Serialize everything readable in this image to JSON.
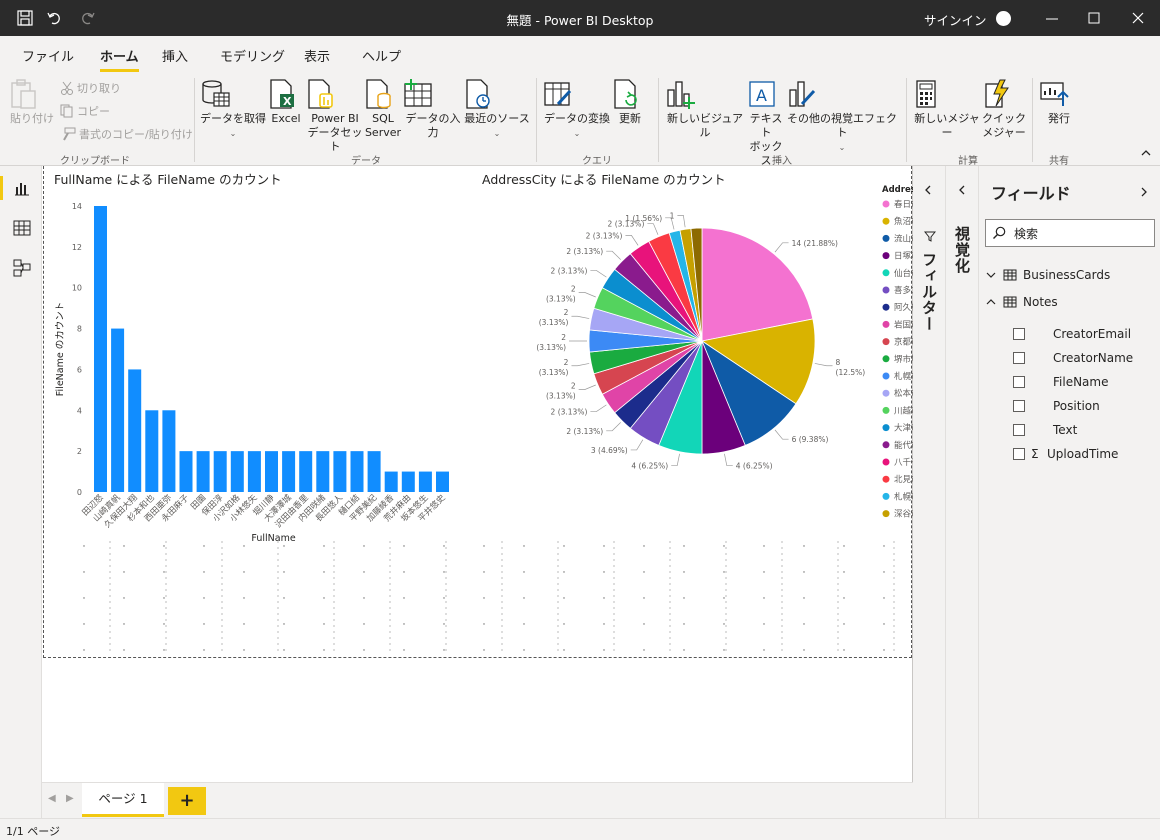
{
  "window": {
    "title": "無題 - Power BI Desktop",
    "signin": "サインイン"
  },
  "tabs": [
    "ファイル",
    "ホーム",
    "挿入",
    "モデリング",
    "表示",
    "ヘルプ"
  ],
  "ribbon": {
    "clipboard": {
      "paste": "貼り付け",
      "cut": "切り取り",
      "copy": "コピー",
      "format_copy": "書式のコピー/貼り付け",
      "label": "クリップボード"
    },
    "data": {
      "get_data": "データを取得",
      "excel": "Excel",
      "powerbi_1": "Power BI",
      "powerbi_2": "データセット",
      "sql_1": "SQL",
      "sql_2": "Server",
      "enter_data": "データの入力",
      "recent": "最近のソース",
      "label": "データ"
    },
    "query": {
      "transform": "データの変換",
      "refresh": "更新",
      "label": "クエリ"
    },
    "insert": {
      "new_visual": "新しいビジュアル",
      "textbox_1": "テキスト",
      "textbox_2": "ボックス",
      "more_visuals": "その他の視覚エフェクト",
      "label": "挿入"
    },
    "calc": {
      "new_measure": "新しいメジャー",
      "quick_1": "クイック",
      "quick_2": "メジャー",
      "label": "計算"
    },
    "share": {
      "publish": "発行",
      "label": "共有"
    }
  },
  "panes": {
    "filters": "フィルター",
    "visualizations": "視覚化",
    "fields": {
      "header": "フィールド",
      "search_placeholder": "検索",
      "tables": [
        {
          "name": "BusinessCards",
          "expanded": false
        },
        {
          "name": "Notes",
          "expanded": true
        }
      ],
      "notes_fields": [
        "CreatorEmail",
        "CreatorName",
        "FileName",
        "Position",
        "Text",
        "UploadTime"
      ]
    }
  },
  "pages": {
    "tab": "ページ 1",
    "add": "+",
    "status": "1/1 ページ"
  },
  "colors": {
    "accent": "#f2c811",
    "bar": "#118dff"
  },
  "chart_data": [
    {
      "type": "bar",
      "title": "FullName による FileName のカウント",
      "xlabel": "FullName",
      "ylabel": "FileName のカウント",
      "ylim": [
        0,
        14
      ],
      "yticks": [
        0,
        2,
        4,
        6,
        8,
        10,
        12,
        14
      ],
      "categories": [
        "田辺怒",
        "山崎真帆",
        "久保田大翔",
        "杉本和也",
        "西田亜弥",
        "永田麻子",
        "田園",
        "保田淳",
        "小沢如格",
        "小林悠矢",
        "堀川静",
        "大澤澤城",
        "沢田由香里",
        "内田咲緒",
        "長田悠人",
        "樋口結",
        "平野美紀",
        "加藤綾香",
        "荒井麻由",
        "坂本悠生",
        "平井悠史"
      ],
      "values": [
        14,
        8,
        6,
        4,
        4,
        2,
        2,
        2,
        2,
        2,
        2,
        2,
        2,
        2,
        2,
        2,
        2,
        1,
        1,
        1,
        1
      ]
    },
    {
      "type": "pie",
      "title": "AddressCity による FileName のカウント",
      "legend_title": "AddressCity",
      "legend": [
        "春日市",
        "魚沼市",
        "流山市",
        "日塚市",
        "仙台市",
        "喜多方市",
        "阿久根市",
        "岩国市",
        "京都市左京区",
        "堺市堺区",
        "札幌市北区",
        "松本市",
        "川越市",
        "大津市",
        "能代市",
        "八千子市",
        "北見市",
        "札幌市中央区",
        "深谷市"
      ],
      "slices": [
        {
          "value": 14,
          "label": "14 (21.88%)",
          "color": "#f472d0"
        },
        {
          "value": 8,
          "label_1": "8",
          "label_2": "(12.5%)",
          "color": "#d9b300"
        },
        {
          "value": 6,
          "label": "6 (9.38%)",
          "color": "#0f5ba7"
        },
        {
          "value": 4,
          "label": "4 (6.25%)",
          "color": "#6b007b"
        },
        {
          "value": 4,
          "label": "4 (6.25%)",
          "color": "#12d6b8"
        },
        {
          "value": 3,
          "label": "3 (4.69%)",
          "color": "#744ec2"
        },
        {
          "value": 2,
          "label": "2 (3.13%)",
          "color": "#1c2c8c"
        },
        {
          "value": 2,
          "label": "2 (3.13%)",
          "color": "#e044a7"
        },
        {
          "value": 2,
          "label_1": "2",
          "label_2": "(3.13%)",
          "color": "#d64550"
        },
        {
          "value": 2,
          "label_1": "2",
          "label_2": "(3.13%)",
          "color": "#1aab40"
        },
        {
          "value": 2,
          "label_1": "2",
          "label_2": "(3.13%)",
          "color": "#3c8af5"
        },
        {
          "value": 2,
          "label_1": "2",
          "label_2": "(3.13%)",
          "color": "#a6a6f5"
        },
        {
          "value": 2,
          "label_1": "2",
          "label_2": "(3.13%)",
          "color": "#54d35e"
        },
        {
          "value": 2,
          "label": "2 (3.13%)",
          "color": "#0b8ecf"
        },
        {
          "value": 2,
          "label": "2 (3.13%)",
          "color": "#8a1b8d"
        },
        {
          "value": 2,
          "label": "2 (3.13%)",
          "color": "#e8137b"
        },
        {
          "value": 2,
          "label": "2 (3.13%)",
          "color": "#fa3a43"
        },
        {
          "value": 1,
          "label": "1 (1.56%)",
          "color": "#25b5e8"
        },
        {
          "value": 1,
          "label": "1",
          "color": "#c6a000"
        },
        {
          "value": 1,
          "label": "",
          "color": "#8d6a00"
        }
      ]
    }
  ]
}
